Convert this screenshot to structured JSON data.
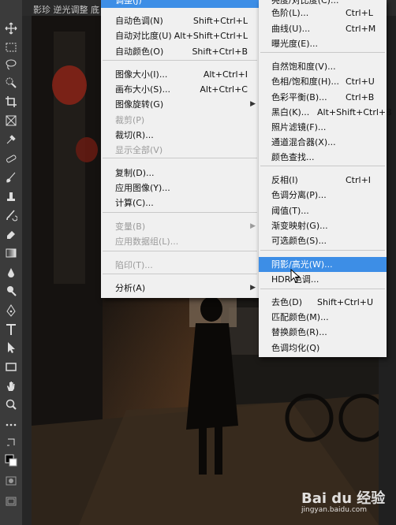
{
  "topbar": {
    "doc_title": "影珍 逆光调整 底"
  },
  "tools": [
    {
      "icon": "move-icon"
    },
    {
      "icon": "marquee-icon"
    },
    {
      "icon": "lasso-icon"
    },
    {
      "icon": "quick-select-icon"
    },
    {
      "icon": "crop-icon"
    },
    {
      "icon": "frame-icon"
    },
    {
      "icon": "eyedropper-icon"
    },
    {
      "icon": "healing-icon"
    },
    {
      "icon": "brush-icon"
    },
    {
      "icon": "stamp-icon"
    },
    {
      "icon": "history-brush-icon"
    },
    {
      "icon": "eraser-icon"
    },
    {
      "icon": "gradient-icon"
    },
    {
      "icon": "blur-icon"
    },
    {
      "icon": "dodge-icon"
    },
    {
      "icon": "pen-icon"
    },
    {
      "icon": "type-icon"
    },
    {
      "icon": "path-select-icon"
    },
    {
      "icon": "rectangle-icon"
    },
    {
      "icon": "hand-icon"
    },
    {
      "icon": "zoom-icon"
    },
    {
      "icon": "more-icon"
    },
    {
      "icon": "swap-colors-icon"
    },
    {
      "icon": "color-swatches-icon"
    },
    {
      "icon": "quick-mask-icon"
    },
    {
      "icon": "screen-mode-icon"
    }
  ],
  "image_menu": {
    "top_label": "调整(J)",
    "items": [
      {
        "label": "自动色调(N)",
        "shortcut": "Shift+Ctrl+L",
        "disabled": false
      },
      {
        "label": "自动对比度(U)",
        "shortcut": "Alt+Shift+Ctrl+L",
        "disabled": false
      },
      {
        "label": "自动颜色(O)",
        "shortcut": "Shift+Ctrl+B",
        "disabled": false
      },
      {
        "label": "图像大小(I)...",
        "shortcut": "Alt+Ctrl+I",
        "disabled": false
      },
      {
        "label": "画布大小(S)...",
        "shortcut": "Alt+Ctrl+C",
        "disabled": false
      },
      {
        "label": "图像旋转(G)",
        "shortcut": "",
        "disabled": false,
        "submenu": true
      },
      {
        "label": "裁剪(P)",
        "shortcut": "",
        "disabled": true
      },
      {
        "label": "裁切(R)...",
        "shortcut": "",
        "disabled": false
      },
      {
        "label": "显示全部(V)",
        "shortcut": "",
        "disabled": true
      },
      {
        "label": "复制(D)...",
        "shortcut": "",
        "disabled": false
      },
      {
        "label": "应用图像(Y)...",
        "shortcut": "",
        "disabled": false
      },
      {
        "label": "计算(C)...",
        "shortcut": "",
        "disabled": false
      },
      {
        "label": "变量(B)",
        "shortcut": "",
        "disabled": true,
        "submenu": true
      },
      {
        "label": "应用数据组(L)...",
        "shortcut": "",
        "disabled": true
      },
      {
        "label": "陷印(T)...",
        "shortcut": "",
        "disabled": true
      },
      {
        "label": "分析(A)",
        "shortcut": "",
        "disabled": false,
        "submenu": true
      }
    ]
  },
  "adjust_menu": {
    "items": [
      {
        "label": "亮度/对比度(C)...",
        "shortcut": ""
      },
      {
        "label": "色阶(L)...",
        "shortcut": "Ctrl+L"
      },
      {
        "label": "曲线(U)...",
        "shortcut": "Ctrl+M"
      },
      {
        "label": "曝光度(E)...",
        "shortcut": ""
      },
      {
        "label": "自然饱和度(V)...",
        "shortcut": ""
      },
      {
        "label": "色相/饱和度(H)...",
        "shortcut": "Ctrl+U"
      },
      {
        "label": "色彩平衡(B)...",
        "shortcut": "Ctrl+B"
      },
      {
        "label": "黑白(K)...",
        "shortcut": "Alt+Shift+Ctrl+B"
      },
      {
        "label": "照片滤镜(F)...",
        "shortcut": ""
      },
      {
        "label": "通道混合器(X)...",
        "shortcut": ""
      },
      {
        "label": "颜色查找...",
        "shortcut": ""
      },
      {
        "label": "反相(I)",
        "shortcut": "Ctrl+I"
      },
      {
        "label": "色调分离(P)...",
        "shortcut": ""
      },
      {
        "label": "阈值(T)...",
        "shortcut": ""
      },
      {
        "label": "渐变映射(G)...",
        "shortcut": ""
      },
      {
        "label": "可选颜色(S)...",
        "shortcut": ""
      },
      {
        "label": "阴影/高光(W)...",
        "shortcut": "",
        "highlight": true
      },
      {
        "label": "HDR 色调...",
        "shortcut": ""
      },
      {
        "label": "去色(D)",
        "shortcut": "Shift+Ctrl+U"
      },
      {
        "label": "匹配颜色(M)...",
        "shortcut": ""
      },
      {
        "label": "替换颜色(R)...",
        "shortcut": ""
      },
      {
        "label": "色调均化(Q)",
        "shortcut": ""
      }
    ]
  },
  "watermark": {
    "brand": "Bai du 经验",
    "url": "jingyan.baidu.com"
  },
  "colors": {
    "highlight": "#3d8ee6",
    "menu_bg": "#f0f0f0",
    "disabled": "#9b9b9b"
  }
}
